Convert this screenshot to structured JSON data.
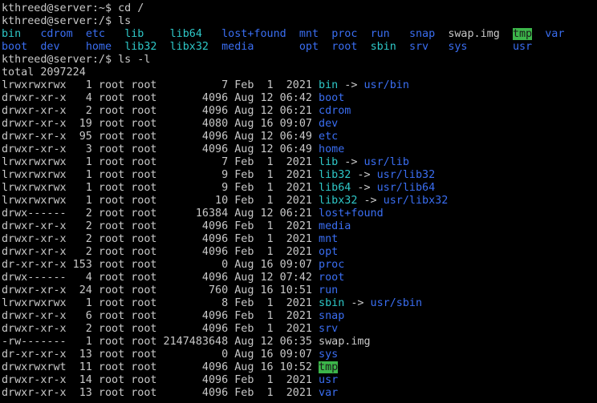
{
  "colors": {
    "background": "#000000",
    "text": "#c8c8c8",
    "directory": "#3a6ef2",
    "symlink": "#2ec8c8",
    "sticky_dir_fg": "#1a1a1a",
    "sticky_dir_bg": "#3cb64a"
  },
  "lines": [
    {
      "segs": [
        {
          "t": "kthreed@server:~$ cd /",
          "c": "plain"
        }
      ]
    },
    {
      "segs": [
        {
          "t": "kthreed@server:/$ ls",
          "c": "plain"
        }
      ]
    },
    {
      "segs": [
        {
          "t": "bin",
          "c": "link"
        },
        {
          "t": "   ",
          "c": "plain"
        },
        {
          "t": "cdrom",
          "c": "dir"
        },
        {
          "t": "  ",
          "c": "plain"
        },
        {
          "t": "etc",
          "c": "dir"
        },
        {
          "t": "   ",
          "c": "plain"
        },
        {
          "t": "lib",
          "c": "link"
        },
        {
          "t": "    ",
          "c": "plain"
        },
        {
          "t": "lib64",
          "c": "link"
        },
        {
          "t": "   ",
          "c": "plain"
        },
        {
          "t": "lost+found",
          "c": "dir"
        },
        {
          "t": "  ",
          "c": "plain"
        },
        {
          "t": "mnt",
          "c": "dir"
        },
        {
          "t": "  ",
          "c": "plain"
        },
        {
          "t": "proc",
          "c": "dir"
        },
        {
          "t": "  ",
          "c": "plain"
        },
        {
          "t": "run",
          "c": "dir"
        },
        {
          "t": "   ",
          "c": "plain"
        },
        {
          "t": "snap",
          "c": "dir"
        },
        {
          "t": "  ",
          "c": "plain"
        },
        {
          "t": "swap.img",
          "c": "plain"
        },
        {
          "t": "  ",
          "c": "plain"
        },
        {
          "t": "tmp",
          "c": "tmp"
        },
        {
          "t": "  ",
          "c": "plain"
        },
        {
          "t": "var",
          "c": "dir"
        }
      ]
    },
    {
      "segs": [
        {
          "t": "boot",
          "c": "dir"
        },
        {
          "t": "  ",
          "c": "plain"
        },
        {
          "t": "dev",
          "c": "dir"
        },
        {
          "t": "    ",
          "c": "plain"
        },
        {
          "t": "home",
          "c": "dir"
        },
        {
          "t": "  ",
          "c": "plain"
        },
        {
          "t": "lib32",
          "c": "link"
        },
        {
          "t": "  ",
          "c": "plain"
        },
        {
          "t": "libx32",
          "c": "link"
        },
        {
          "t": "  ",
          "c": "plain"
        },
        {
          "t": "media",
          "c": "dir"
        },
        {
          "t": "       ",
          "c": "plain"
        },
        {
          "t": "opt",
          "c": "dir"
        },
        {
          "t": "  ",
          "c": "plain"
        },
        {
          "t": "root",
          "c": "dir"
        },
        {
          "t": "  ",
          "c": "plain"
        },
        {
          "t": "sbin",
          "c": "link"
        },
        {
          "t": "  ",
          "c": "plain"
        },
        {
          "t": "srv",
          "c": "dir"
        },
        {
          "t": "   ",
          "c": "plain"
        },
        {
          "t": "sys",
          "c": "dir"
        },
        {
          "t": "       ",
          "c": "plain"
        },
        {
          "t": "usr",
          "c": "dir"
        }
      ]
    },
    {
      "segs": [
        {
          "t": "kthreed@server:/$ ls -l",
          "c": "plain"
        }
      ]
    },
    {
      "segs": [
        {
          "t": "total 2097224",
          "c": "plain"
        }
      ]
    },
    {
      "segs": [
        {
          "t": "lrwxrwxrwx   1 root root          7 Feb  1  2021 ",
          "c": "plain"
        },
        {
          "t": "bin",
          "c": "link"
        },
        {
          "t": " -> ",
          "c": "arrow"
        },
        {
          "t": "usr/bin",
          "c": "dir"
        }
      ]
    },
    {
      "segs": [
        {
          "t": "drwxr-xr-x   4 root root       4096 Aug 12 06:42 ",
          "c": "plain"
        },
        {
          "t": "boot",
          "c": "dir"
        }
      ]
    },
    {
      "segs": [
        {
          "t": "drwxr-xr-x   2 root root       4096 Aug 12 06:21 ",
          "c": "plain"
        },
        {
          "t": "cdrom",
          "c": "dir"
        }
      ]
    },
    {
      "segs": [
        {
          "t": "drwxr-xr-x  19 root root       4080 Aug 16 09:07 ",
          "c": "plain"
        },
        {
          "t": "dev",
          "c": "dir"
        }
      ]
    },
    {
      "segs": [
        {
          "t": "drwxr-xr-x  95 root root       4096 Aug 12 06:49 ",
          "c": "plain"
        },
        {
          "t": "etc",
          "c": "dir"
        }
      ]
    },
    {
      "segs": [
        {
          "t": "drwxr-xr-x   3 root root       4096 Aug 12 06:49 ",
          "c": "plain"
        },
        {
          "t": "home",
          "c": "dir"
        }
      ]
    },
    {
      "segs": [
        {
          "t": "lrwxrwxrwx   1 root root          7 Feb  1  2021 ",
          "c": "plain"
        },
        {
          "t": "lib",
          "c": "link"
        },
        {
          "t": " -> ",
          "c": "arrow"
        },
        {
          "t": "usr/lib",
          "c": "dir"
        }
      ]
    },
    {
      "segs": [
        {
          "t": "lrwxrwxrwx   1 root root          9 Feb  1  2021 ",
          "c": "plain"
        },
        {
          "t": "lib32",
          "c": "link"
        },
        {
          "t": " -> ",
          "c": "arrow"
        },
        {
          "t": "usr/lib32",
          "c": "dir"
        }
      ]
    },
    {
      "segs": [
        {
          "t": "lrwxrwxrwx   1 root root          9 Feb  1  2021 ",
          "c": "plain"
        },
        {
          "t": "lib64",
          "c": "link"
        },
        {
          "t": " -> ",
          "c": "arrow"
        },
        {
          "t": "usr/lib64",
          "c": "dir"
        }
      ]
    },
    {
      "segs": [
        {
          "t": "lrwxrwxrwx   1 root root         10 Feb  1  2021 ",
          "c": "plain"
        },
        {
          "t": "libx32",
          "c": "link"
        },
        {
          "t": " -> ",
          "c": "arrow"
        },
        {
          "t": "usr/libx32",
          "c": "dir"
        }
      ]
    },
    {
      "segs": [
        {
          "t": "drwx------   2 root root      16384 Aug 12 06:21 ",
          "c": "plain"
        },
        {
          "t": "lost+found",
          "c": "dir"
        }
      ]
    },
    {
      "segs": [
        {
          "t": "drwxr-xr-x   2 root root       4096 Feb  1  2021 ",
          "c": "plain"
        },
        {
          "t": "media",
          "c": "dir"
        }
      ]
    },
    {
      "segs": [
        {
          "t": "drwxr-xr-x   2 root root       4096 Feb  1  2021 ",
          "c": "plain"
        },
        {
          "t": "mnt",
          "c": "dir"
        }
      ]
    },
    {
      "segs": [
        {
          "t": "drwxr-xr-x   2 root root       4096 Feb  1  2021 ",
          "c": "plain"
        },
        {
          "t": "opt",
          "c": "dir"
        }
      ]
    },
    {
      "segs": [
        {
          "t": "dr-xr-xr-x 153 root root          0 Aug 16 09:07 ",
          "c": "plain"
        },
        {
          "t": "proc",
          "c": "dir"
        }
      ]
    },
    {
      "segs": [
        {
          "t": "drwx------   4 root root       4096 Aug 12 07:42 ",
          "c": "plain"
        },
        {
          "t": "root",
          "c": "dir"
        }
      ]
    },
    {
      "segs": [
        {
          "t": "drwxr-xr-x  24 root root        760 Aug 16 10:51 ",
          "c": "plain"
        },
        {
          "t": "run",
          "c": "dir"
        }
      ]
    },
    {
      "segs": [
        {
          "t": "lrwxrwxrwx   1 root root          8 Feb  1  2021 ",
          "c": "plain"
        },
        {
          "t": "sbin",
          "c": "link"
        },
        {
          "t": " -> ",
          "c": "arrow"
        },
        {
          "t": "usr/sbin",
          "c": "dir"
        }
      ]
    },
    {
      "segs": [
        {
          "t": "drwxr-xr-x   6 root root       4096 Feb  1  2021 ",
          "c": "plain"
        },
        {
          "t": "snap",
          "c": "dir"
        }
      ]
    },
    {
      "segs": [
        {
          "t": "drwxr-xr-x   2 root root       4096 Feb  1  2021 ",
          "c": "plain"
        },
        {
          "t": "srv",
          "c": "dir"
        }
      ]
    },
    {
      "segs": [
        {
          "t": "-rw-------   1 root root 2147483648 Aug 12 06:35 ",
          "c": "plain"
        },
        {
          "t": "swap.img",
          "c": "plain"
        }
      ]
    },
    {
      "segs": [
        {
          "t": "dr-xr-xr-x  13 root root          0 Aug 16 09:07 ",
          "c": "plain"
        },
        {
          "t": "sys",
          "c": "dir"
        }
      ]
    },
    {
      "segs": [
        {
          "t": "drwxrwxrwt  11 root root       4096 Aug 16 10:52 ",
          "c": "plain"
        },
        {
          "t": "tmp",
          "c": "tmp"
        }
      ]
    },
    {
      "segs": [
        {
          "t": "drwxr-xr-x  14 root root       4096 Feb  1  2021 ",
          "c": "plain"
        },
        {
          "t": "usr",
          "c": "dir"
        }
      ]
    },
    {
      "segs": [
        {
          "t": "drwxr-xr-x  13 root root       4096 Feb  1  2021 ",
          "c": "plain"
        },
        {
          "t": "var",
          "c": "dir"
        }
      ]
    }
  ]
}
